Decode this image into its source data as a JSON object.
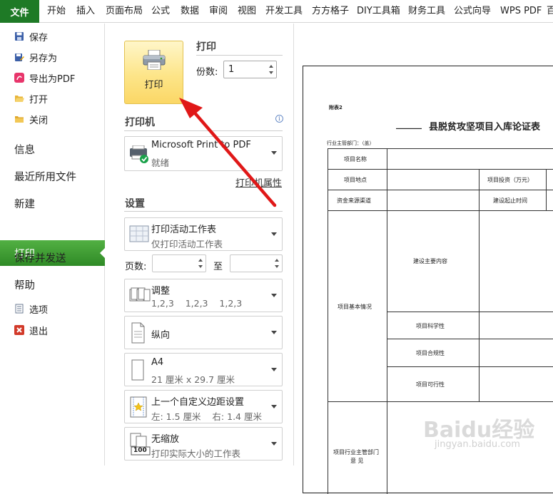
{
  "ribbon": {
    "file_tab": "文件",
    "tabs": [
      "开始",
      "插入",
      "页面布局",
      "公式",
      "数据",
      "审阅",
      "视图",
      "开发工具",
      "方方格子",
      "DIY工具箱",
      "财务工具",
      "公式向导",
      "WPS PDF",
      "百"
    ]
  },
  "nav": {
    "save": "保存",
    "save_as": "另存为",
    "export_pdf": "导出为PDF",
    "open": "打开",
    "close": "关闭",
    "info": "信息",
    "recent": "最近所用文件",
    "new": "新建",
    "print": "打印",
    "save_send": "保存并发送",
    "help": "帮助",
    "options": "选项",
    "exit": "退出"
  },
  "print": {
    "heading": "打印",
    "button_label": "打印",
    "copies_label": "份数:",
    "copies_value": "1",
    "printer_heading": "打印机",
    "printer_name": "Microsoft Print to PDF",
    "printer_status": "就绪",
    "printer_props": "打印机属性",
    "settings_heading": "设置",
    "scope_main": "打印活动工作表",
    "scope_sub": "仅打印活动工作表",
    "pages_label": "页数:",
    "pages_to": "至",
    "pages_from_value": "",
    "pages_to_value": "",
    "collate_main": "调整",
    "collate_sub": "1,2,3    1,2,3    1,2,3",
    "orientation": "纵向",
    "paper_main": "A4",
    "paper_sub": "21 厘米 x 29.7 厘米",
    "margin_main": "上一个自定义边距设置",
    "margin_sub": "左: 1.5 厘米    右: 1.4 厘米",
    "scale_main": "无缩放",
    "scale_sub": "打印实际大小的工作表",
    "scale_icon_text": "100"
  },
  "preview": {
    "attachment": "附表2",
    "title_blank": "______",
    "title": "县脱贫攻坚项目入库论证表",
    "dept": "行业主管部门：（盖）",
    "rows": {
      "name": "项目名称",
      "location": "项目地点",
      "investment": "项目投资（万元）",
      "funding": "资金来源渠道",
      "period": "建设起止时间",
      "content": "建设主要内容",
      "basic": "项目基本情况",
      "science": "项目科学性",
      "compliance": "项目合规性",
      "feasibility": "项目可行性",
      "opinion1": "项目行业主管部门",
      "opinion2": "意 见"
    },
    "watermark1": "Baidu经验",
    "watermark2": "jingyan.baidu.com"
  },
  "colors": {
    "file_green": "#1e7a26",
    "print_green": "#3a9a2e",
    "arrow_red": "#e01818"
  }
}
